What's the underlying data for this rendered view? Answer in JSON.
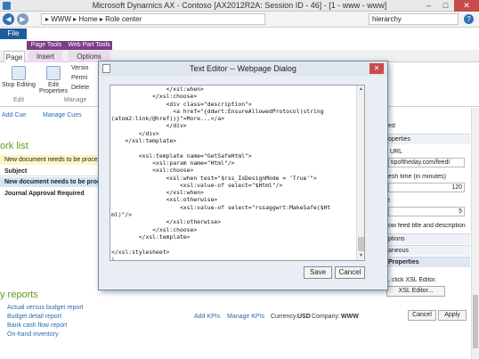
{
  "window": {
    "title": "Microsoft Dynamics AX - Contoso [AX2012R2A: Session ID - 46] - [1 - www - www]",
    "min": "–",
    "max": "□",
    "close": "✕"
  },
  "address": {
    "breadcrumb": "▸ WWW ▸ Home ▸ Role center",
    "search_value": "hierarchy",
    "help": "?"
  },
  "ribbon": {
    "file_tab": "File",
    "context_groups": [
      "Page Tools",
      "Web Part Tools"
    ],
    "tabs": [
      "Page",
      "Insert",
      "Options"
    ],
    "buttons": {
      "stop_editing": "Stop Editing",
      "edit_properties": "Edit Properties",
      "versions": "Versio",
      "permissions": "Permi",
      "delete": "Delete"
    },
    "group_labels": [
      "Edit",
      "Manage"
    ]
  },
  "left": {
    "cues": [
      "Add Cue",
      "Manage Cues"
    ],
    "work_list_title": "ork list",
    "work_items": [
      "New document needs to be processed",
      "Subject",
      "New document needs to be processed",
      "Journal Approval Required"
    ],
    "reports_title": "y reports",
    "reports": [
      "Actual versus budget report",
      "Budget detail report",
      "Bank cash flow report",
      "On-hand inventory"
    ]
  },
  "right": {
    "header_partial": "ed",
    "properties_section": "operties",
    "url_label": "URL",
    "url_value": "tipoftheday.com/feed/",
    "refresh_label": "esh time (in minutes)",
    "refresh_value": "120",
    "count_label": "t",
    "count_value": "5",
    "show_feed": "ow feed title and description",
    "options_section": "ptions",
    "misc_section": "aneous",
    "props_section": "Properties",
    "xsl_hint": ", click XSL Editor.",
    "xsl_button": "XSL Editor...",
    "cancel": "Cancel",
    "apply": "Apply"
  },
  "center": {
    "add_kpis": "Add KPIs",
    "manage_kpis": "Manage KPIs",
    "currency_label": "Currency:",
    "currency_value": "USD",
    "company_label": "Company:",
    "company_value": "WWW"
  },
  "dialog": {
    "title": "Text Editor -- Webpage Dialog",
    "close": "✕",
    "code_lines": [
      "                </xsl:when>",
      "            </xsl:choose>",
      "                <div class=\"description\">",
      "                  <a href=\"{ddwrt:EnsureAllowedProtocol(string",
      "(atom2:link/@href))}\">More...</a>",
      "                </div>",
      "        </div>",
      "    </xsl:template>",
      "",
      "        <xsl:template name=\"GetSafeHtml\">",
      "            <xsl:param name=\"Html\"/>",
      "            <xsl:choose>",
      "                <xsl:when test=\"$rss_IsDesignMode = 'True'\">",
      "                    <xsl:value-of select=\"$Html\"/>",
      "                </xsl:when>",
      "                <xsl:otherwise>",
      "                    <xsl:value-of select=\"rssaggwrt:MakeSafe($Ht",
      "ml)\"/>",
      "                </xsl:otherwise>",
      "            </xsl:choose>",
      "        </xsl:template>",
      "",
      "</xsl:stylesheet>",
      "|"
    ],
    "save": "Save",
    "cancel": "Cancel"
  }
}
